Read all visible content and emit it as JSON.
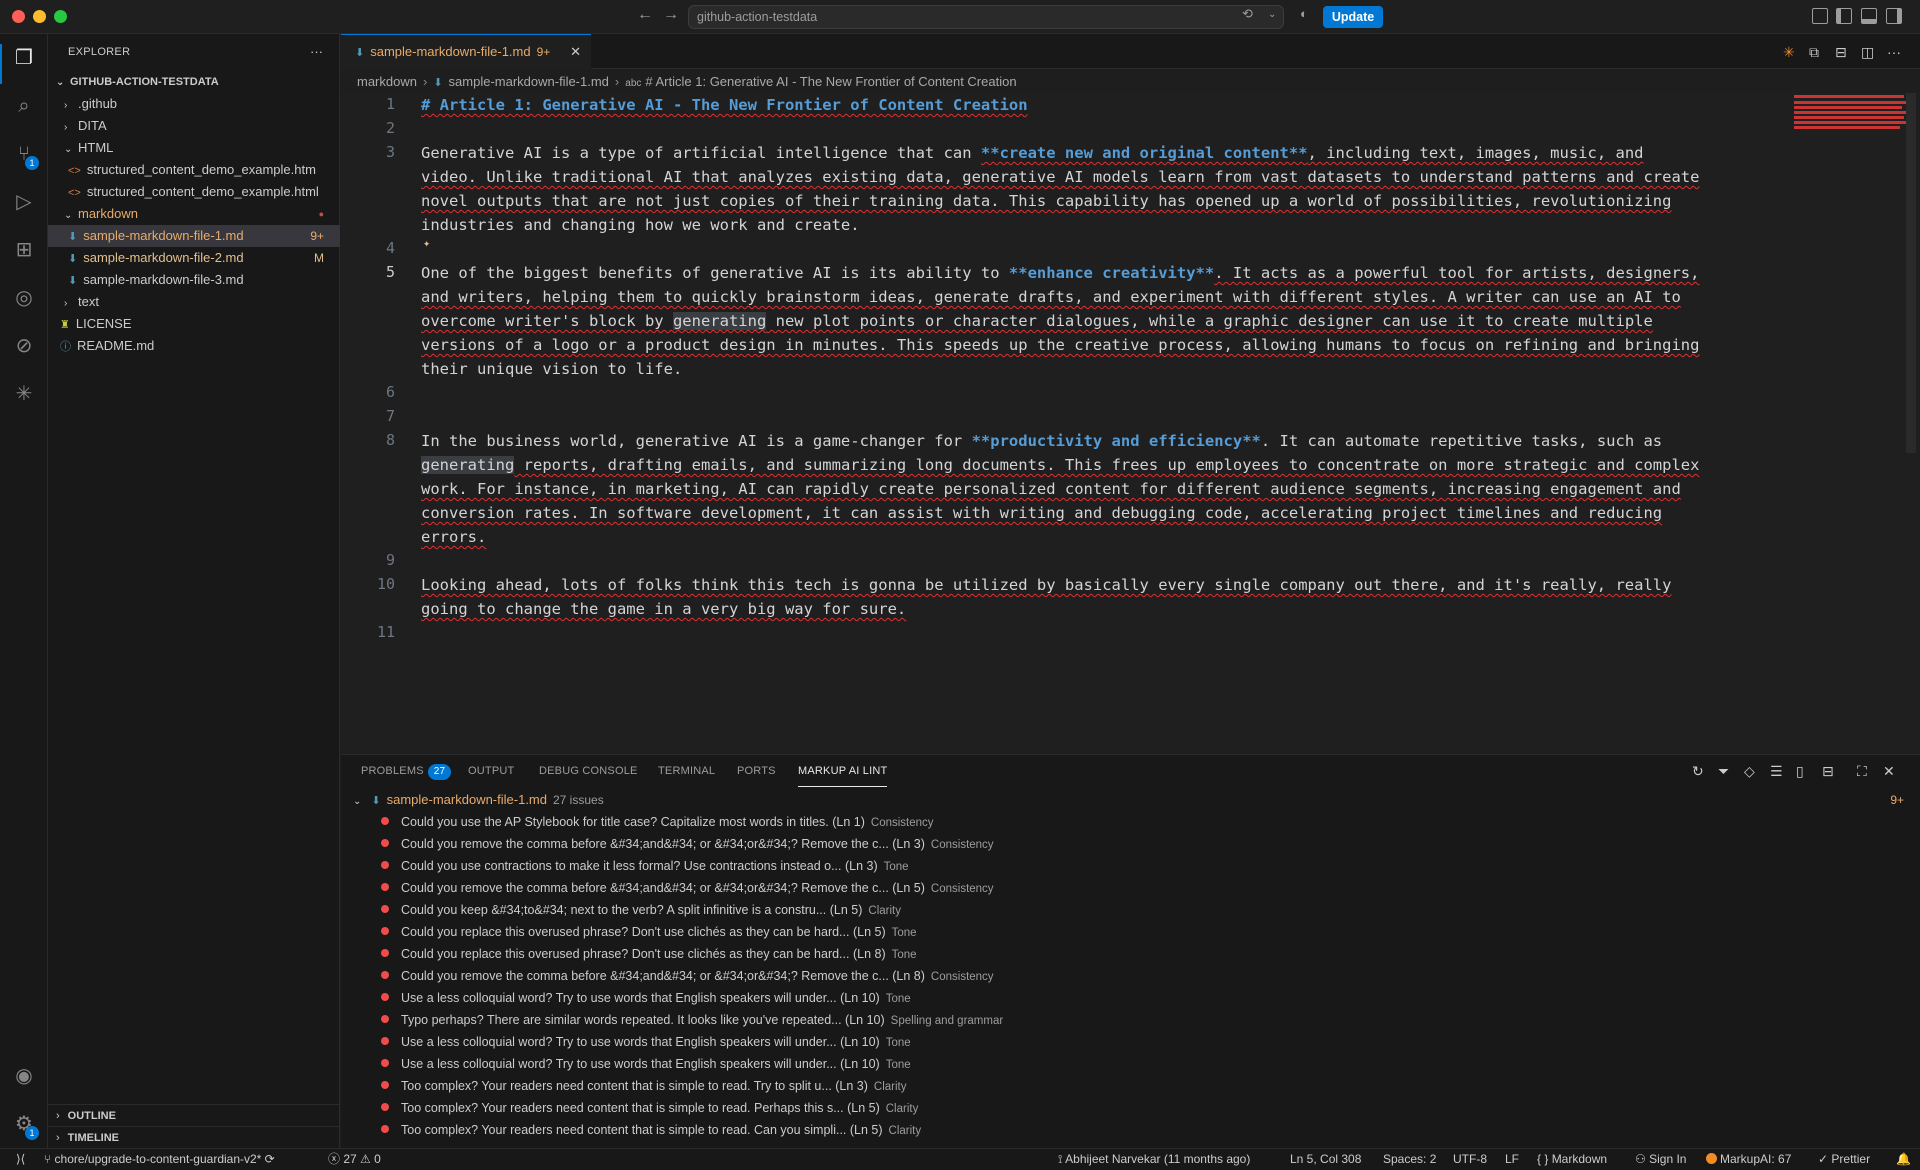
{
  "window": {
    "command_center": "github-action-testdata",
    "update_label": "Update"
  },
  "activity": {
    "source_control_badge": "1",
    "settings_badge": "1"
  },
  "explorer": {
    "title": "EXPLORER",
    "more": "···",
    "root": "GITHUB-ACTION-TESTDATA",
    "items": [
      {
        "label": ".github",
        "chev": "›"
      },
      {
        "label": "DITA",
        "chev": "›"
      },
      {
        "label": "HTML",
        "chev": "⌄"
      },
      {
        "label": "structured_content_demo_example.htm"
      },
      {
        "label": "structured_content_demo_example.html"
      },
      {
        "label": "markdown",
        "chev": "⌄"
      },
      {
        "label": "sample-markdown-file-1.md",
        "badge": "9+"
      },
      {
        "label": "sample-markdown-file-2.md",
        "badge": "M"
      },
      {
        "label": "sample-markdown-file-3.md"
      },
      {
        "label": "text",
        "chev": "›"
      },
      {
        "label": "LICENSE"
      },
      {
        "label": "README.md"
      }
    ],
    "outline": "OUTLINE",
    "timeline": "TIMELINE"
  },
  "editor": {
    "tab_label": "sample-markdown-file-1.md",
    "tab_count": "9+",
    "breadcrumb": [
      "markdown",
      "sample-markdown-file-1.md",
      "# Article 1: Generative AI - The New Frontier of Content Creation"
    ],
    "line_numbers": [
      "1",
      "2",
      "3",
      "4",
      "5",
      "6",
      "7",
      "8",
      "9",
      "10",
      "11"
    ],
    "lines": {
      "l1": "# Article 1: Generative AI - The New Frontier of Content Creation",
      "l3a_1": "Generative AI is a type of artificial intelligence that can ",
      "l3a_b": "**create new and original content**",
      "l3a_2": ", including text, images, music, and",
      "l3b": "video. Unlike traditional AI that analyzes existing data, generative AI models learn from vast datasets to understand patterns and create",
      "l3c": "novel outputs that are not just copies of their training data. This capability has opened up a world of possibilities, revolutionizing",
      "l3d": "industries and changing how we work and create.",
      "l5a_1": "One of the biggest benefits of generative AI is its ability to ",
      "l5a_b": "**enhance creativity**",
      "l5a_2": ". It acts as a powerful tool for artists, designers,",
      "l5b": "and writers, helping them to quickly brainstorm ideas, generate drafts, and experiment with different styles. A writer can use an AI to",
      "l5c_1": "overcome writer's block by ",
      "l5c_h": "generating",
      "l5c_2": " new plot points or character dialogues, while a graphic designer can use it to create multiple",
      "l5d": "versions of a logo or a product design in minutes. This speeds up the creative process, allowing humans to focus on refining and bringing",
      "l5e": "their unique vision to life.",
      "l8a_1": "In the business world, generative AI is a game-changer for ",
      "l8a_b": "**productivity and efficiency**",
      "l8a_2": ". It can automate repetitive tasks, such as",
      "l8b_h": "generating",
      "l8b_2": " reports, drafting emails, and summarizing long documents. This frees up employees to concentrate on more strategic and complex",
      "l8c": "work. For instance, in marketing, AI can rapidly create personalized content for different audience segments, increasing engagement and",
      "l8d": "conversion rates. In software development, it can assist with writing and debugging code, accelerating project timelines and reducing",
      "l8e": "errors.",
      "l10a": "Looking ahead, lots of folks think this tech is gonna be utilized by basically every single company out there, and it's really, really",
      "l10b": "going to change the game in a very big way for sure."
    }
  },
  "panel": {
    "tabs": [
      "PROBLEMS",
      "OUTPUT",
      "DEBUG CONSOLE",
      "TERMINAL",
      "PORTS",
      "MARKUP AI LINT"
    ],
    "problems_count": "27",
    "file_label": "sample-markdown-file-1.md",
    "file_issues": "27 issues",
    "file_count": "9+",
    "issues": [
      {
        "text": "Could you use the AP Stylebook for title case? Capitalize most words in titles. (Ln 1)",
        "cat": "Consistency"
      },
      {
        "text": "Could you remove the comma before &#34;and&#34; or &#34;or&#34;? Remove the c... (Ln 3)",
        "cat": "Consistency"
      },
      {
        "text": "Could you use contractions to make it less formal? Use contractions instead o... (Ln 3)",
        "cat": "Tone"
      },
      {
        "text": "Could you remove the comma before &#34;and&#34; or &#34;or&#34;? Remove the c... (Ln 5)",
        "cat": "Consistency"
      },
      {
        "text": "Could you keep &#34;to&#34; next to the verb? A split infinitive is a constru... (Ln 5)",
        "cat": "Clarity"
      },
      {
        "text": "Could you replace this overused phrase? Don't use clichés as they can be hard... (Ln 5)",
        "cat": "Tone"
      },
      {
        "text": "Could you replace this overused phrase? Don't use clichés as they can be hard... (Ln 8)",
        "cat": "Tone"
      },
      {
        "text": "Could you remove the comma before &#34;and&#34; or &#34;or&#34;? Remove the c... (Ln 8)",
        "cat": "Consistency"
      },
      {
        "text": "Use a less colloquial word? Try to use words that English speakers will under... (Ln 10)",
        "cat": "Tone"
      },
      {
        "text": "Typo perhaps? There are similar words repeated. It looks like you've repeated... (Ln 10)",
        "cat": "Spelling and grammar"
      },
      {
        "text": "Use a less colloquial word? Try to use words that English speakers will under... (Ln 10)",
        "cat": "Tone"
      },
      {
        "text": "Use a less colloquial word? Try to use words that English speakers will under... (Ln 10)",
        "cat": "Tone"
      },
      {
        "text": "Too complex? Your readers need content that is simple to read. Try to split u... (Ln 3)",
        "cat": "Clarity"
      },
      {
        "text": "Too complex? Your readers need content that is simple to read. Perhaps this s... (Ln 5)",
        "cat": "Clarity"
      },
      {
        "text": "Too complex? Your readers need content that is simple to read. Can you simpli... (Ln 5)",
        "cat": "Clarity"
      }
    ]
  },
  "status": {
    "branch": "chore/upgrade-to-content-guardian-v2*",
    "errors": "27",
    "warnings": "0",
    "blame": "Abhijeet Narvekar (11 months ago)",
    "position": "Ln 5, Col 308",
    "spaces": "Spaces: 2",
    "encoding": "UTF-8",
    "eol": "LF",
    "language": "Markdown",
    "sign_in": "Sign In",
    "markupai": "MarkupAI: 67",
    "prettier": "Prettier"
  },
  "colors": {
    "accent": "#0078d4",
    "modified": "#e8ab6a",
    "error": "#f14c4c",
    "heading": "#569cd6"
  }
}
